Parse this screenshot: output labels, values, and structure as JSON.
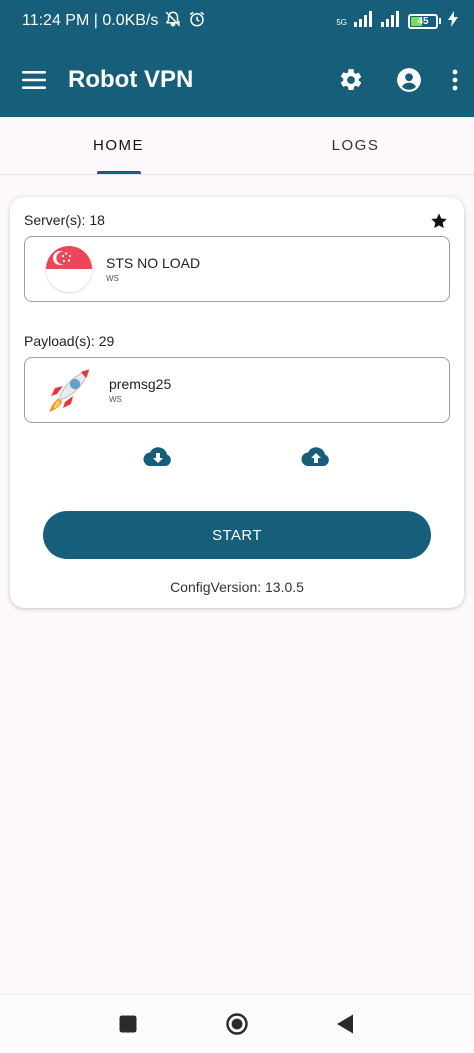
{
  "status_bar": {
    "time_speed": "11:24 PM | 0.0KB/s",
    "network_type": "5G",
    "battery_level": "45",
    "battery_fraction": 0.45,
    "icons": [
      "mute-notifications-icon",
      "alarm-icon",
      "signal-icon",
      "signal-icon",
      "battery-icon",
      "charging-bolt-icon"
    ]
  },
  "app_bar": {
    "title": "Robot VPN",
    "icons": [
      "menu-icon",
      "settings-gear-icon",
      "account-icon",
      "more-vertical-icon"
    ]
  },
  "tabs": [
    {
      "label": "HOME",
      "active": true
    },
    {
      "label": "LOGS",
      "active": false
    }
  ],
  "server": {
    "label": "Server(s): 18",
    "name": "STS NO LOAD",
    "subtitle": "WS",
    "flag_icon": "singapore-flag-icon",
    "favorite_icon": "star-icon"
  },
  "payload": {
    "label": "Payload(s): 29",
    "name": "premsg25",
    "subtitle": "WS",
    "icon": "rocket-icon"
  },
  "actions": {
    "icons": [
      "cloud-download-icon",
      "cloud-upload-icon"
    ],
    "start_label": "START"
  },
  "config_version": "ConfigVersion: 13.0.5",
  "nav_bar": {
    "icons": [
      "recents-square-icon",
      "home-circle-icon",
      "back-triangle-icon"
    ]
  },
  "colors": {
    "primary": "#175e7a",
    "background": "#fcf8fb",
    "card": "#ffffff"
  }
}
